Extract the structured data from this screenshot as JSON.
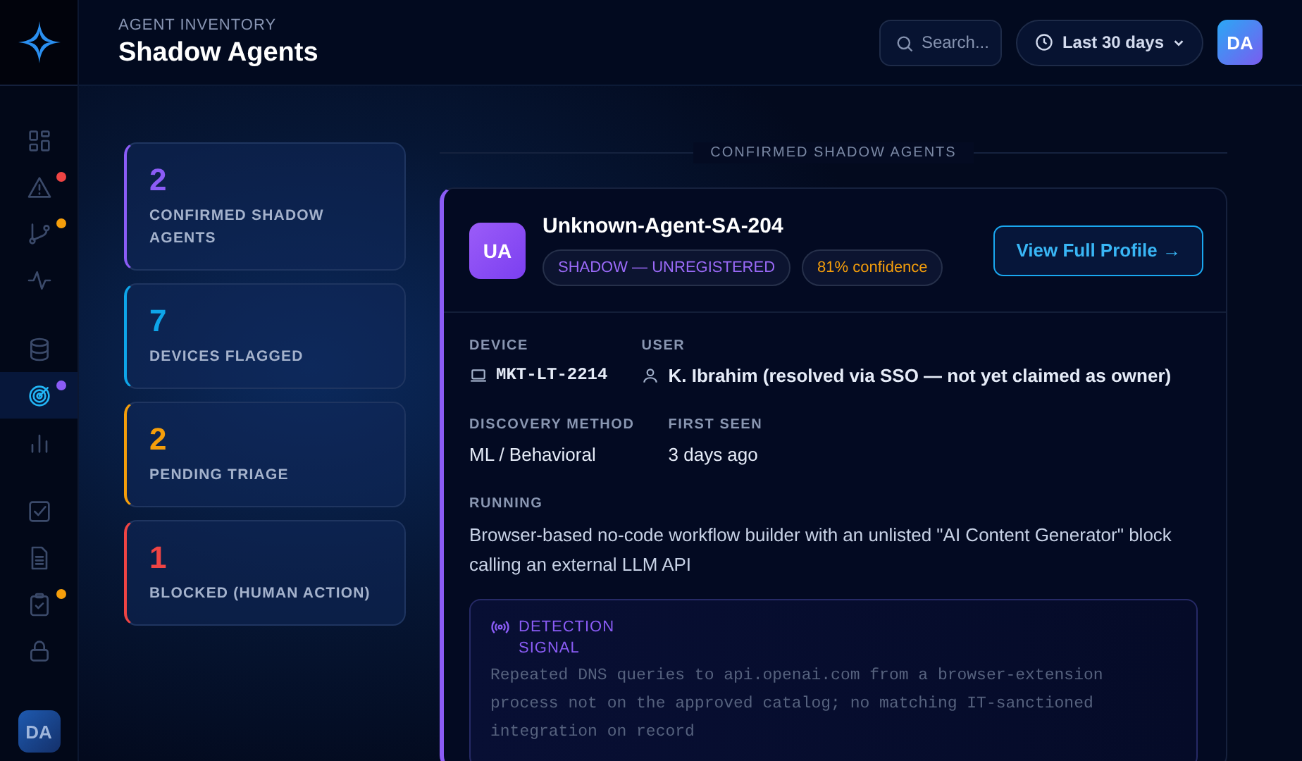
{
  "sidebar": {
    "items": [
      {
        "kind": "grid",
        "selected": false
      },
      {
        "kind": "alert",
        "selected": false,
        "color": "#ef4444"
      },
      {
        "kind": "branch",
        "selected": false,
        "color": "#f59e0b"
      },
      {
        "kind": "pulse",
        "selected": false
      },
      {
        "kind": "database",
        "selected": false
      },
      {
        "kind": "radar",
        "selected": true,
        "color": "#8b5cf6"
      },
      {
        "kind": "bars",
        "selected": false
      },
      {
        "kind": "checkbox",
        "selected": false
      },
      {
        "kind": "document",
        "selected": false
      },
      {
        "kind": "clipboard",
        "selected": false,
        "color": "#f59e0b"
      },
      {
        "kind": "lock",
        "selected": false
      }
    ],
    "avatar": "DA"
  },
  "header": {
    "eyebrow": "AGENT INVENTORY",
    "title": "Shadow Agents",
    "search": {
      "placeholder": "Search..."
    },
    "range": "Last 30 days",
    "avatar": "DA"
  },
  "stats": [
    {
      "value": "2",
      "label": "CONFIRMED SHADOW AGENTS",
      "color": "#8b5cf6"
    },
    {
      "value": "7",
      "label": "DEVICES FLAGGED",
      "color": "#0ea5e9"
    },
    {
      "value": "2",
      "label": "PENDING TRIAGE",
      "color": "#f59e0b"
    },
    {
      "value": "1",
      "label": "BLOCKED (HUMAN ACTION)",
      "color": "#ef4444"
    }
  ],
  "section_title": "CONFIRMED SHADOW AGENTS",
  "agent": {
    "initials": "UA",
    "name": "Unknown-Agent-SA-204",
    "status": "SHADOW — UNREGISTERED",
    "confidence": "81% confidence",
    "button": "View Full Profile →",
    "device_label": "DEVICE",
    "device": "MKT-LT-2214",
    "user_label": "USER",
    "user": "K. Ibrahim (resolved via SSO — not yet claimed as owner)",
    "method_label": "DISCOVERY METHOD",
    "method": "ML / Behavioral",
    "first_seen_label": "FIRST SEEN",
    "first_seen": "3 days ago",
    "running_label": "RUNNING",
    "running": "Browser-based no-code workflow builder with an unlisted \"AI Content Generator\" block calling an external LLM API",
    "signal_label": "DETECTION SIGNAL",
    "signal": "Repeated DNS queries to api.openai.com from a browser-extension process not on the approved catalog; no matching IT-sanctioned integration on record"
  }
}
